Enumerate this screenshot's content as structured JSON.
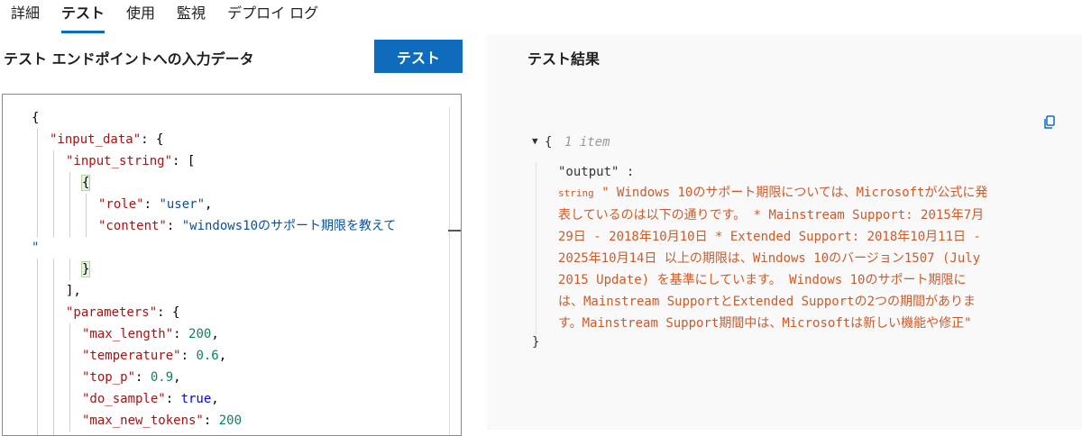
{
  "tabs": [
    "詳細",
    "テスト",
    "使用",
    "監視",
    "デプロイ ログ"
  ],
  "active_tab": "テスト",
  "input": {
    "title": "テスト エンドポイントへの入力データ",
    "button_label": "テスト",
    "code_lines": [
      [
        {
          "t": "{",
          "c": "p"
        }
      ],
      [
        {
          "t": "\"input_data\"",
          "c": "k"
        },
        {
          "t": ": {",
          "c": "p"
        }
      ],
      [
        {
          "t": "\"input_string\"",
          "c": "k"
        },
        {
          "t": ": [",
          "c": "p"
        }
      ],
      [
        {
          "t": "{",
          "c": "p"
        }
      ],
      [
        {
          "t": "\"role\"",
          "c": "k"
        },
        {
          "t": ": ",
          "c": "p"
        },
        {
          "t": "\"user\"",
          "c": "s"
        },
        {
          "t": ",",
          "c": "p"
        }
      ],
      [
        {
          "t": "\"content\"",
          "c": "k"
        },
        {
          "t": ": ",
          "c": "p"
        },
        {
          "t": "\"windows10のサポート期限を教えて",
          "c": "s"
        }
      ],
      [
        {
          "t": "\"",
          "c": "s"
        }
      ],
      [
        {
          "t": "}",
          "c": "p"
        }
      ],
      [
        {
          "t": "],",
          "c": "p"
        }
      ],
      [
        {
          "t": "\"parameters\"",
          "c": "k"
        },
        {
          "t": ": {",
          "c": "p"
        }
      ],
      [
        {
          "t": "\"max_length\"",
          "c": "k"
        },
        {
          "t": ": ",
          "c": "p"
        },
        {
          "t": "200",
          "c": "n"
        },
        {
          "t": ",",
          "c": "p"
        }
      ],
      [
        {
          "t": "\"temperature\"",
          "c": "k"
        },
        {
          "t": ": ",
          "c": "p"
        },
        {
          "t": "0.6",
          "c": "n"
        },
        {
          "t": ",",
          "c": "p"
        }
      ],
      [
        {
          "t": "\"top_p\"",
          "c": "k"
        },
        {
          "t": ": ",
          "c": "p"
        },
        {
          "t": "0.9",
          "c": "n"
        },
        {
          "t": ",",
          "c": "p"
        }
      ],
      [
        {
          "t": "\"do_sample\"",
          "c": "k"
        },
        {
          "t": ": ",
          "c": "p"
        },
        {
          "t": "true",
          "c": "b"
        },
        {
          "t": ",",
          "c": "p"
        }
      ],
      [
        {
          "t": "\"max_new_tokens\"",
          "c": "k"
        },
        {
          "t": ": ",
          "c": "p"
        },
        {
          "t": "200",
          "c": "n"
        }
      ],
      [
        {
          "t": "}",
          "c": "p"
        }
      ]
    ]
  },
  "result": {
    "title": "テスト結果",
    "item_count": "1 item",
    "key": "\"output\" :",
    "type_label": "string",
    "value_lines": [
      "\" Windows 10のサポート期限については、Microsoftが公式に発",
      "表しているのは以下の通りです。 * Mainstream Support: 2015年7月",
      "29日 - 2018年10月10日 * Extended Support: 2018年10月11日 -",
      "2025年10月14日 以上の期限は、Windows 10のバージョン1507 (July",
      "2015 Update) を基準にしています。 Windows 10のサポート期限に",
      "は、Mainstream SupportとExtended Supportの2つの期間がありま",
      "す。Mainstream Support期間中は、Microsoftは新しい機能や修正\""
    ],
    "open_brace": "{",
    "close_brace": "}",
    "caret": "▼"
  },
  "colors": {
    "accent": "#0f6cbd",
    "result_text": "#cb5b2b"
  }
}
